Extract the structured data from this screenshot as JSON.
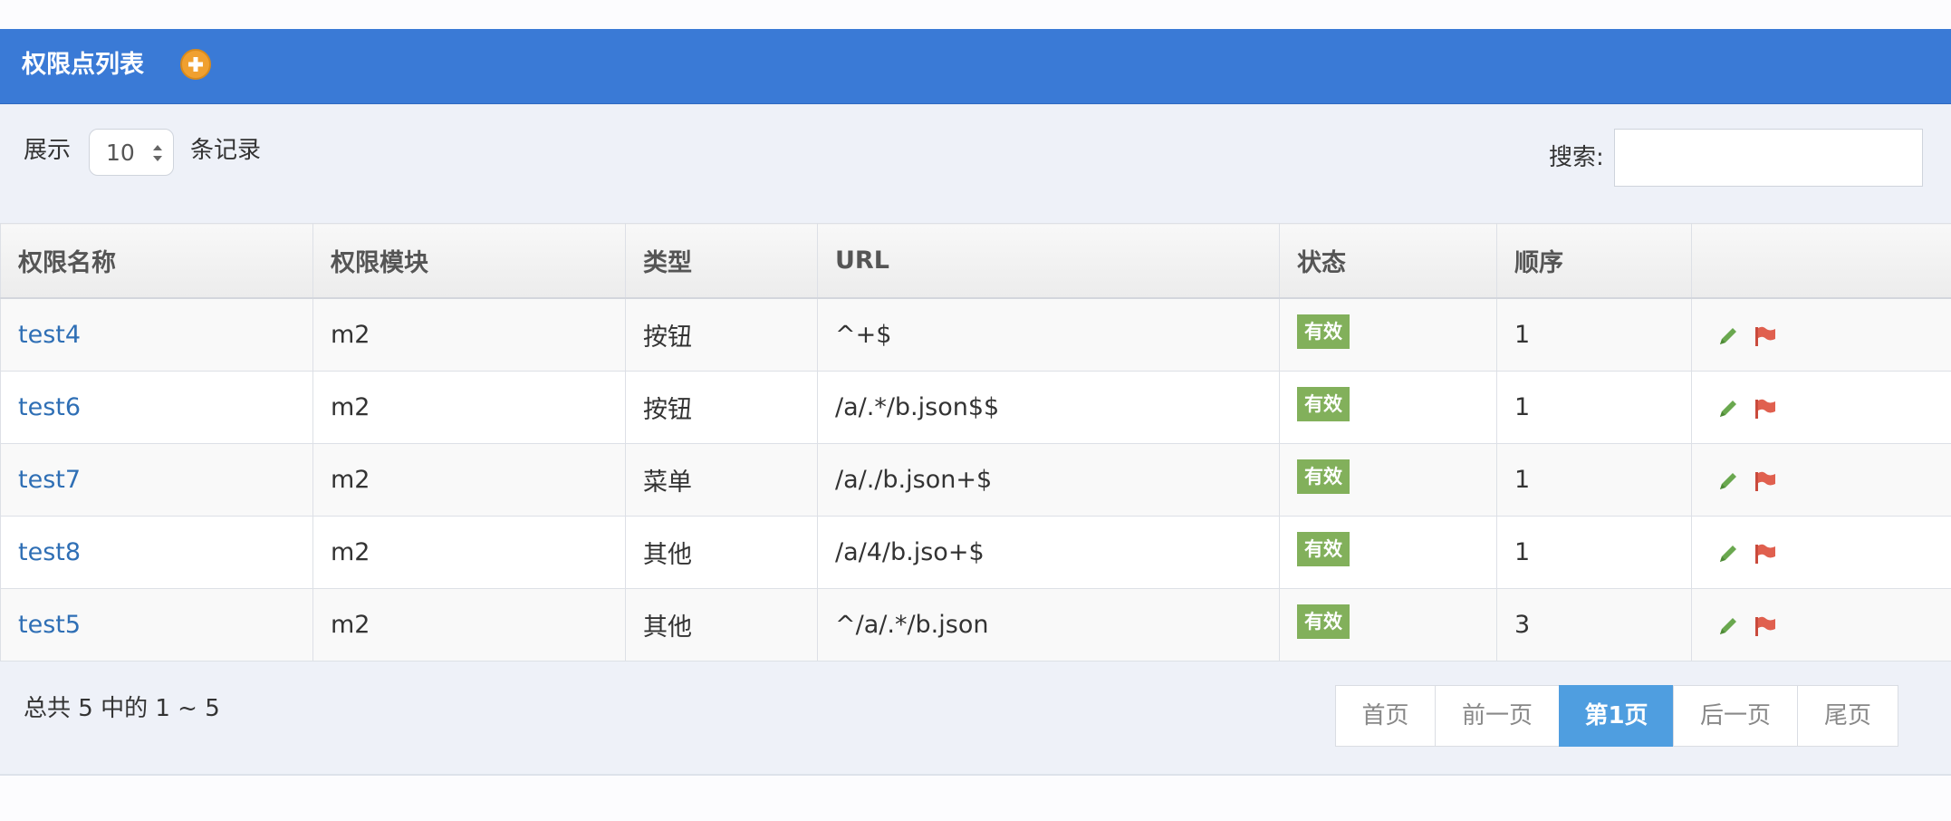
{
  "panel": {
    "title": "权限点列表",
    "add_icon": "plus-circle-icon"
  },
  "length": {
    "prefix": "展示",
    "value": "10",
    "suffix": "条记录"
  },
  "search": {
    "label": "搜索:",
    "value": ""
  },
  "table": {
    "columns": [
      "权限名称",
      "权限模块",
      "类型",
      "URL",
      "状态",
      "顺序",
      ""
    ],
    "rows": [
      {
        "name": "test4",
        "module": "m2",
        "type": "按钮",
        "url": "^+$",
        "status": "有效",
        "order": "1"
      },
      {
        "name": "test6",
        "module": "m2",
        "type": "按钮",
        "url": "/a/.*/b.json$$",
        "status": "有效",
        "order": "1"
      },
      {
        "name": "test7",
        "module": "m2",
        "type": "菜单",
        "url": "/a/./b.json+$",
        "status": "有效",
        "order": "1"
      },
      {
        "name": "test8",
        "module": "m2",
        "type": "其他",
        "url": "/a/4/b.jso+$",
        "status": "有效",
        "order": "1"
      },
      {
        "name": "test5",
        "module": "m2",
        "type": "其他",
        "url": "^/a/.*/b.json",
        "status": "有效",
        "order": "3"
      }
    ],
    "row_actions": {
      "edit_icon": "pencil-icon",
      "flag_icon": "flag-icon"
    }
  },
  "summary": "总共 5 中的 1 ~ 5",
  "pagination": {
    "first": "首页",
    "prev": "前一页",
    "current": "第1页",
    "next": "后一页",
    "last": "尾页"
  },
  "colors": {
    "header_blue": "#3a7ad6",
    "badge_green": "#82b05b",
    "active_page": "#4f9ee0",
    "link": "#2f6fb5",
    "pencil": "#6aa84f",
    "flag": "#e0604f",
    "add": "#f0a030"
  }
}
